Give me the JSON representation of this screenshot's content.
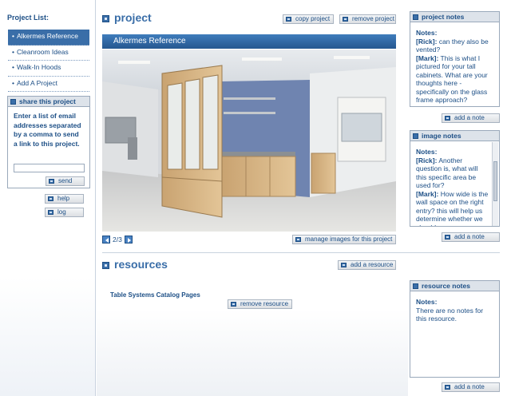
{
  "sidebar": {
    "title": "Project List:",
    "items": [
      {
        "label": "Alkermes Reference",
        "active": true
      },
      {
        "label": "Cleanroom Ideas",
        "active": false
      },
      {
        "label": "Walk-In Hoods",
        "active": false
      },
      {
        "label": "Add A Project",
        "active": false
      }
    ],
    "share": {
      "title": "share this project",
      "text": "Enter a list of email addresses separated by a comma to send a link to this project.",
      "input_value": "",
      "send_label": "send"
    },
    "help_label": "help",
    "log_label": "log"
  },
  "project": {
    "title": "project",
    "copy_label": "copy project",
    "remove_label": "remove project",
    "image_title": "Alkermes Reference",
    "pager": "2/3",
    "manage_label": "manage images for this project"
  },
  "resources": {
    "title": "resources",
    "add_label": "add a resource",
    "items": [
      {
        "label": "Table Systems Catalog Pages",
        "remove_label": "remove resource"
      }
    ]
  },
  "project_notes": {
    "title": "project notes",
    "heading": "Notes:",
    "entries": [
      {
        "author": "[Rick]:",
        "text": " can they also be vented?"
      },
      {
        "author": "[Mark]:",
        "text": " This is what I pictured for your tall cabinets. What are your thoughts here - specifically on the glass frame approach?"
      }
    ],
    "add_label": "add a note"
  },
  "image_notes": {
    "title": "image notes",
    "heading": "Notes:",
    "entries": [
      {
        "author": "[Rick]:",
        "text": " Another question is, what will this specific area be used for?"
      },
      {
        "author": "[Mark]:",
        "text": " How wide is the wall space on the right entry? this will help us determine whether we should"
      }
    ],
    "add_label": "add a note"
  },
  "resource_notes": {
    "title": "resource notes",
    "heading": "Notes:",
    "text": "There are no notes for this resource.",
    "add_label": "add a note"
  },
  "colors": {
    "accent": "#3a6ea8",
    "text": "#1d4f86",
    "border": "#9aa9bb",
    "panel_head": "#dde3ea"
  }
}
